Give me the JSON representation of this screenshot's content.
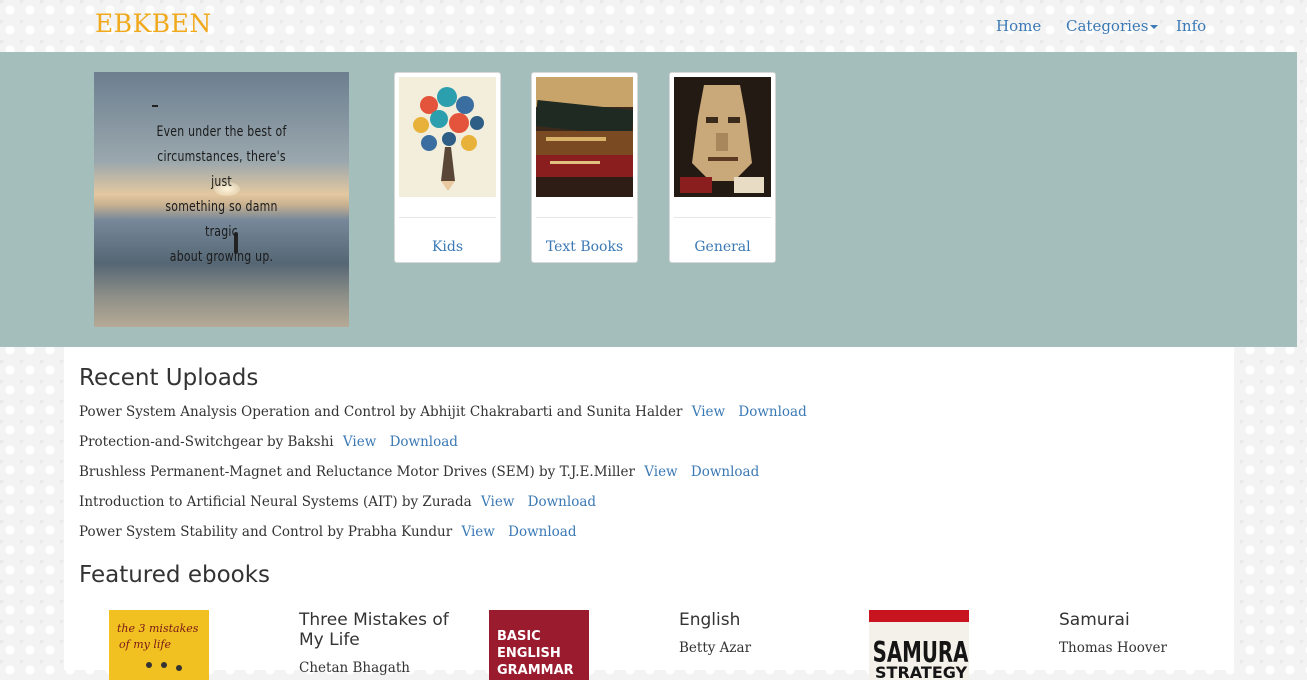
{
  "navbar": {
    "brand": "EBKBEN",
    "links": {
      "home": "Home",
      "categories": "Categories",
      "info": "Info"
    }
  },
  "hero": {
    "quote_lines": [
      "Even under the best of",
      "circumstances, there's just",
      "something so damn tragic",
      "about growing up."
    ],
    "categories": [
      {
        "label": "Kids",
        "icon": "tree-of-speech-bubbles-image"
      },
      {
        "label": "Text Books",
        "icon": "stack-of-books-image"
      },
      {
        "label": "General",
        "icon": "book-sculpture-image"
      }
    ]
  },
  "recent": {
    "title": "Recent Uploads",
    "items": [
      {
        "text": "Power System Analysis Operation and Control by Abhijit Chakrabarti and Sunita Halder",
        "view": "View",
        "download": "Download"
      },
      {
        "text": "Protection-and-Switchgear by Bakshi",
        "view": "View",
        "download": "Download"
      },
      {
        "text": "Brushless Permanent-Magnet and Reluctance Motor Drives (SEM) by T.J.E.Miller",
        "view": "View",
        "download": "Download"
      },
      {
        "text": "Introduction to Artificial Neural Systems (AIT) by Zurada",
        "view": "View",
        "download": "Download"
      },
      {
        "text": "Power System Stability and Control by Prabha Kundur",
        "view": "View",
        "download": "Download"
      }
    ]
  },
  "featured": {
    "title": "Featured ebooks",
    "books": [
      {
        "title": "Three Mistakes of My Life",
        "author": "Chetan Bhagath",
        "cover_text": "the 3 mistakes of my life"
      },
      {
        "title": "English",
        "author": "Betty Azar",
        "cover_text": "BASIC ENGLISH GRAMMAR"
      },
      {
        "title": "Samurai",
        "author": "Thomas Hoover",
        "cover_text": "SAMURAI STRATEGY"
      }
    ]
  },
  "colors": {
    "brand": "#f0a91a",
    "link": "#3a79b5",
    "hero_bg": "#a4bfbb",
    "text": "#333333"
  }
}
